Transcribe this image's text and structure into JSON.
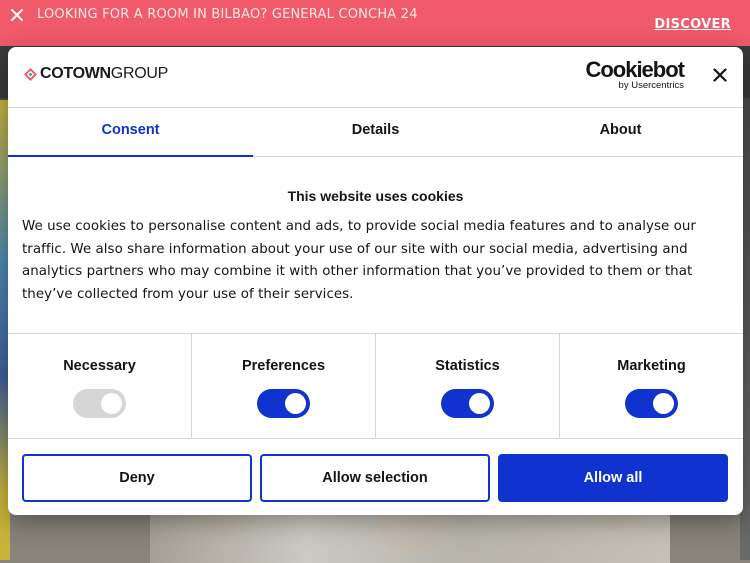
{
  "banner": {
    "text": "LOOKING FOR A ROOM IN BILBAO? GENERAL CONCHA 24",
    "link": "DISCOVER",
    "close_icon": "close-icon",
    "bg_color": "#f05a6a"
  },
  "dialog": {
    "brand": {
      "bold": "COTOWN",
      "light": "GROUP"
    },
    "provider": {
      "name": "Cookiebot",
      "sub": "by Usercentrics"
    },
    "close_icon": "close-icon",
    "tabs": [
      {
        "label": "Consent",
        "active": true
      },
      {
        "label": "Details",
        "active": false
      },
      {
        "label": "About",
        "active": false
      }
    ],
    "title": "This website uses cookies",
    "body": "We use cookies to personalise content and ads, to provide social media features and to analyse our traffic. We also share information about your use of our site with our social media, advertising and analytics partners who may combine it with other information that you’ve provided to them or that they’ve collected from your use of their services.",
    "categories": [
      {
        "label": "Necessary",
        "enabled": true,
        "locked": true
      },
      {
        "label": "Preferences",
        "enabled": true,
        "locked": false
      },
      {
        "label": "Statistics",
        "enabled": true,
        "locked": false
      },
      {
        "label": "Marketing",
        "enabled": true,
        "locked": false
      }
    ],
    "buttons": {
      "deny": "Deny",
      "allow_selection": "Allow selection",
      "allow_all": "Allow all"
    },
    "accent_color": "#1032cf"
  }
}
